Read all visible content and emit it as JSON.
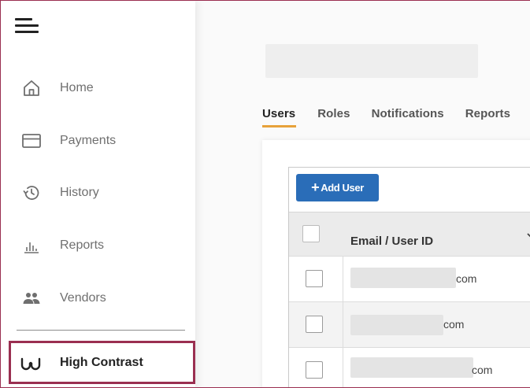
{
  "sidebar": {
    "menu_icon": "hamburger-icon",
    "items": [
      {
        "label": "Home",
        "icon": "home-icon"
      },
      {
        "label": "Payments",
        "icon": "card-icon"
      },
      {
        "label": "History",
        "icon": "history-icon"
      },
      {
        "label": "Reports",
        "icon": "bar-chart-icon"
      },
      {
        "label": "Vendors",
        "icon": "people-icon"
      }
    ],
    "high_contrast": {
      "label": "High Contrast",
      "icon": "glasses-icon"
    }
  },
  "main": {
    "tabs": [
      {
        "label": "Users",
        "active": true
      },
      {
        "label": "Roles",
        "active": false
      },
      {
        "label": "Notifications",
        "active": false
      },
      {
        "label": "Reports",
        "active": false
      }
    ],
    "add_user_label": "Add User",
    "table": {
      "columns": [
        {
          "label": "Email / User ID"
        }
      ],
      "rows": [
        {
          "email_suffix": "com"
        },
        {
          "email_suffix": "com"
        },
        {
          "email_suffix": "com"
        }
      ]
    }
  },
  "colors": {
    "accent": "#9a2f51",
    "tab_underline": "#e7a23a",
    "button_blue": "#2a6db8"
  }
}
